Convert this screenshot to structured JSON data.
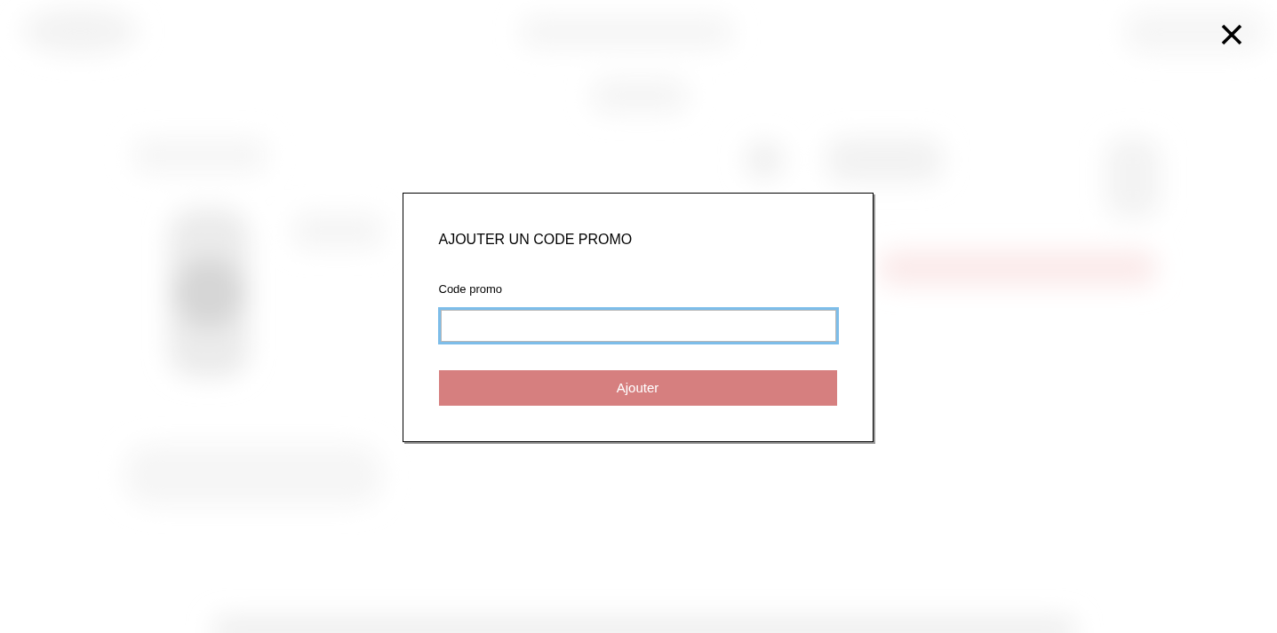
{
  "dialog": {
    "title": "AJOUTER UN CODE PROMO",
    "field": {
      "label": "Code promo",
      "focused": true
    },
    "submit_button": {
      "label": "Ajouter"
    }
  }
}
